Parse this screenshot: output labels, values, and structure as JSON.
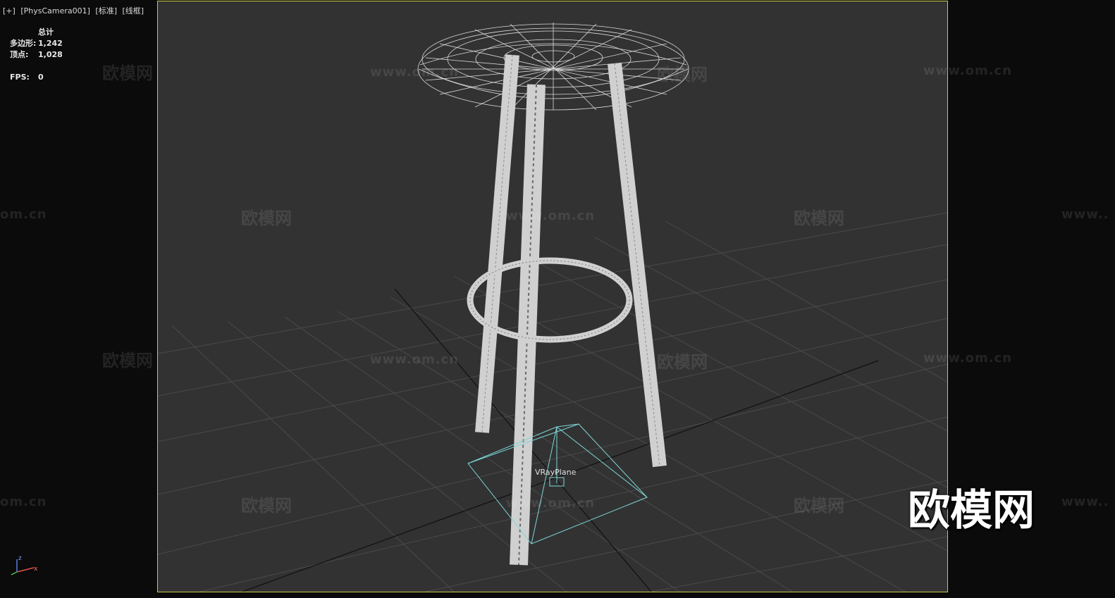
{
  "viewport": {
    "labels": [
      "[+]",
      "[PhysCamera001]",
      "[标准]",
      "[线框]"
    ]
  },
  "stats": {
    "header": "总计",
    "polygons_label": "多边形:",
    "polygons_value": "1,242",
    "vertices_label": "顶点:",
    "vertices_value": "1,028",
    "fps_label": "FPS:",
    "fps_value": "0"
  },
  "scene": {
    "object_label": "VRayPlane"
  },
  "watermarks": {
    "brand": "欧模网",
    "url": "www.om.cn",
    "url_fragment_left": "om.cn",
    "url_fragment_right": "www..",
    "big": "欧模网"
  },
  "gizmo": {
    "z": "z",
    "x": "x"
  },
  "colors": {
    "viewport_bg": "#323232",
    "active_border": "#c8c84a",
    "wire": "#d8d8d8",
    "helper": "#7fd6d6",
    "grid": "#4a4a4a"
  }
}
